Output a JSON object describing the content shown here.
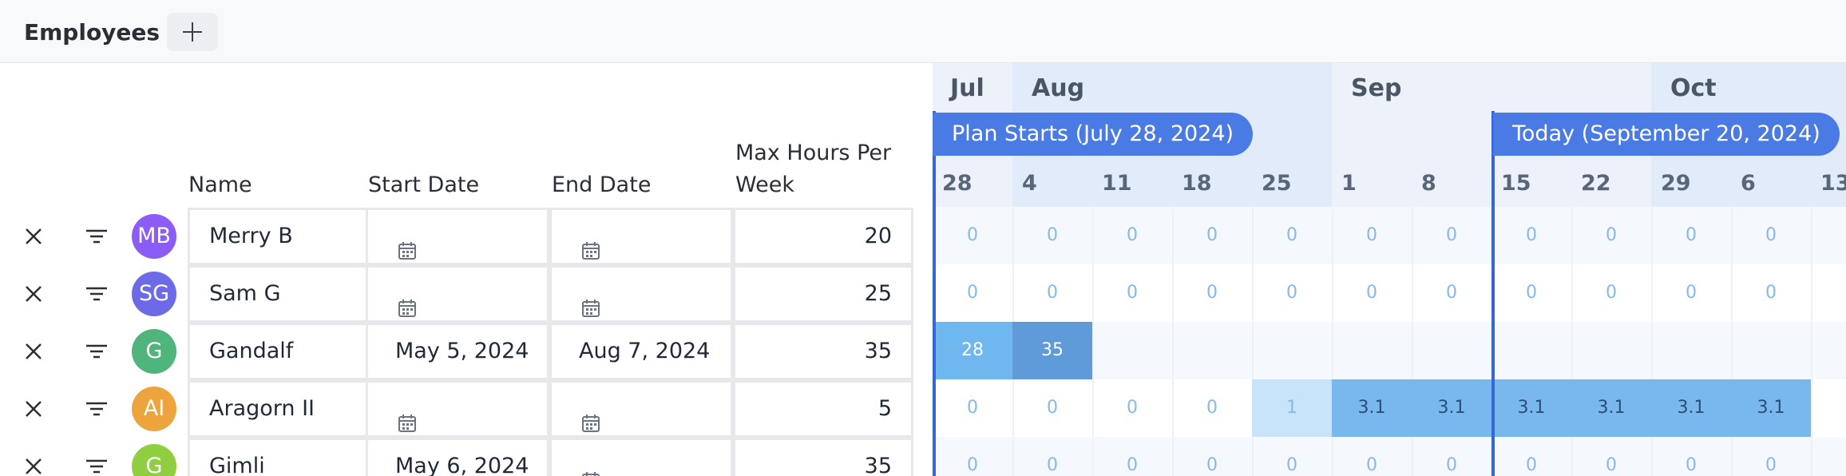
{
  "header": {
    "title": "Employees",
    "add_label": "+"
  },
  "columns": {
    "name": "Name",
    "start": "Start Date",
    "end": "End Date",
    "max": "Max Hours Per Week"
  },
  "employees": [
    {
      "initials": "MB",
      "avatar_color": "#8b5cf6",
      "name": "Merry B",
      "start": "",
      "end": "",
      "max": "20"
    },
    {
      "initials": "SG",
      "avatar_color": "#6d6ae8",
      "name": "Sam G",
      "start": "",
      "end": "",
      "max": "25"
    },
    {
      "initials": "G",
      "avatar_color": "#4fb57b",
      "name": "Gandalf",
      "start": "May 5, 2024",
      "end": "Aug 7, 2024",
      "max": "35"
    },
    {
      "initials": "AI",
      "avatar_color": "#eea43c",
      "name": "Aragorn II",
      "start": "",
      "end": "",
      "max": "5"
    },
    {
      "initials": "G",
      "avatar_color": "#8fcf3f",
      "name": "Gimli",
      "start": "May 6, 2024",
      "end": "",
      "max": "35"
    }
  ],
  "timeline": {
    "months": [
      "Jul",
      "Aug",
      "Sep",
      "Oct"
    ],
    "weeks": [
      "28",
      "4",
      "11",
      "18",
      "25",
      "1",
      "8",
      "15",
      "22",
      "29",
      "6",
      "13"
    ],
    "plan_marker": "Plan Starts (July 28, 2024)",
    "today_marker": "Today (September 20, 2024)",
    "rows": [
      [
        "0",
        "0",
        "0",
        "0",
        "0",
        "0",
        "0",
        "0",
        "0",
        "0",
        "0",
        ""
      ],
      [
        "0",
        "0",
        "0",
        "0",
        "0",
        "0",
        "0",
        "0",
        "0",
        "0",
        "0",
        ""
      ],
      [
        "28",
        "35",
        "",
        "",
        "",
        "",
        "",
        "",
        "",
        "",
        "",
        ""
      ],
      [
        "0",
        "0",
        "0",
        "0",
        "1",
        "3.1",
        "3.1",
        "3.1",
        "3.1",
        "3.1",
        "3.1",
        ""
      ],
      [
        "0",
        "0",
        "0",
        "0",
        "0",
        "0",
        "0",
        "0",
        "0",
        "0",
        "0",
        ""
      ]
    ]
  },
  "colors": {
    "accent": "#3765d6",
    "marker": "#4a7be5"
  },
  "icons": [
    "plus-icon",
    "close-icon",
    "filter-icon",
    "calendar-icon"
  ]
}
